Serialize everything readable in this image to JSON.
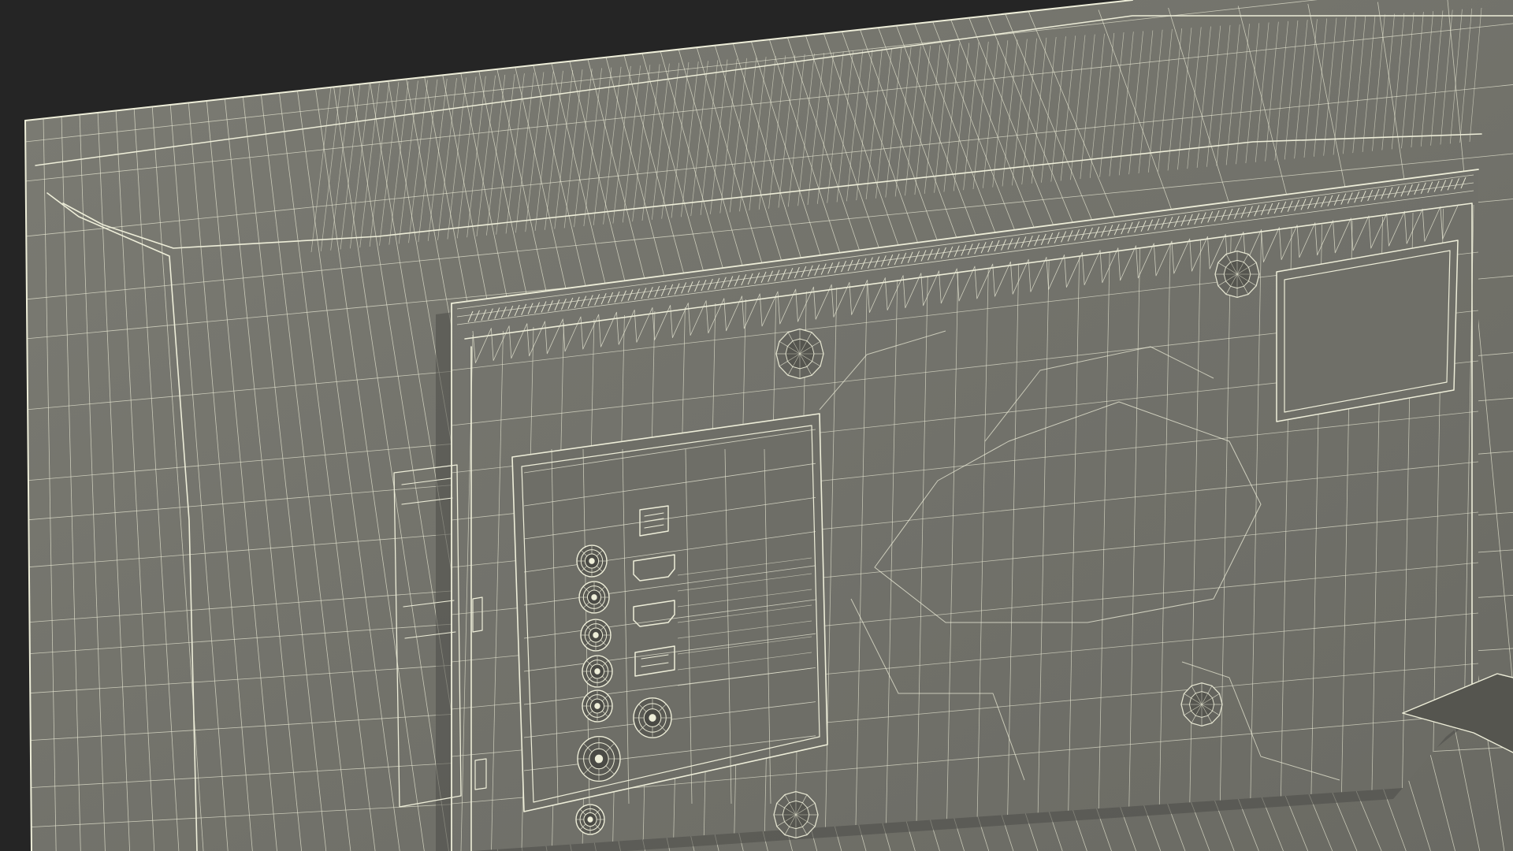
{
  "scene": {
    "subject": "tv-back-panel-wireframe",
    "colors": {
      "background": "#252525",
      "panel_fill": "#72726b",
      "panel_fill_dark": "#5f5f59",
      "wire": "#eeeed9",
      "shadow": "#484844"
    }
  }
}
